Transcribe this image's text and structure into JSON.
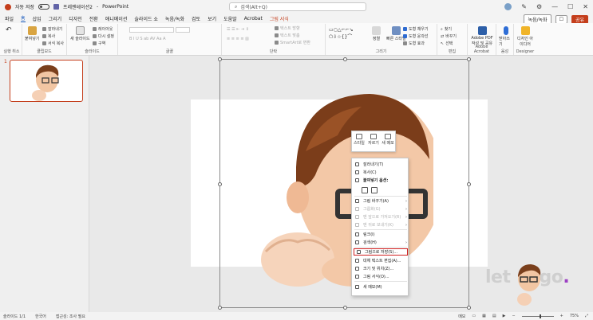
{
  "titlebar": {
    "autosave": "자동 저장",
    "filename": "프레젠테이션2",
    "separator": "-",
    "app": "PowerPoint",
    "search_placeholder": "검색(Alt+Q)"
  },
  "tabs": [
    "파일",
    "홈",
    "삽입",
    "그리기",
    "디자인",
    "전환",
    "애니메이션",
    "슬라이드 쇼",
    "녹음/녹화",
    "검토",
    "보기",
    "도움말",
    "Acrobat",
    "그림 서식"
  ],
  "tab_right": {
    "record": "녹음/녹화",
    "share": "공유"
  },
  "ribbon": {
    "undo_label": "실행 취소",
    "clipboard_label": "클립보드",
    "paste": "붙여넣기",
    "cut": "잘라내기",
    "copy": "복사",
    "format_painter": "서식 복사",
    "new_slide": "새 슬라이드",
    "layout": "레이아웃",
    "reset": "다시 설정",
    "section": "구역",
    "slides_label": "슬라이드",
    "font_label": "글꼴",
    "para_label": "단락",
    "text_dir": "텍스트 방향",
    "text_align": "텍스트 맞춤",
    "smartart": "SmartArt로 변환",
    "drawing_label": "그리기",
    "arrange": "정렬",
    "quick_styles": "빠른 스타일",
    "shape_fill": "도형 채우기",
    "shape_outline": "도형 윤곽선",
    "shape_effects": "도형 효과",
    "find": "찾기",
    "replace": "바꾸기",
    "select": "선택",
    "editing_label": "편집",
    "adobe_pdf": "Adobe PDF 작성 및 공유",
    "acrobat_label": "Adobe Acrobat",
    "dictate": "받아쓰기",
    "voice_label": "음성",
    "designer_btn": "디자인 아이디어",
    "designer_label": "Designer"
  },
  "slide_panel": {
    "number": "1"
  },
  "minibar": {
    "style": "스타일",
    "crop": "자르기",
    "new_comment": "새 메모"
  },
  "context_menu": {
    "cut": "잘라내기(T)",
    "copy": "복사(C)",
    "paste_options": "붙여넣기 옵션:",
    "change_picture": "그림 바꾸기(A)",
    "group": "그룹화(G)",
    "bring_front": "맨 앞으로 가져오기(R)",
    "send_back": "맨 뒤로 보내기(K)",
    "link": "링크(I)",
    "search": "검색(H)",
    "save_as_picture": "그림으로 저장(S)...",
    "alt_text": "대체 텍스트 편집(A)...",
    "size_position": "크기 및 위치(Z)...",
    "format_picture": "그림 서식(O)...",
    "new_comment": "새 메모(M)"
  },
  "watermark": {
    "text_a": "let",
    "text_b": "go",
    "dot": "."
  },
  "status": {
    "slide_info": "슬라이드 1/1",
    "language": "한국어",
    "accessibility": "접근성: 조사 필요",
    "notes": "메모",
    "zoom": "75%"
  },
  "colors": {
    "accent": "#c43e1c",
    "highlight": "#d02020",
    "blue": "#185abd"
  }
}
